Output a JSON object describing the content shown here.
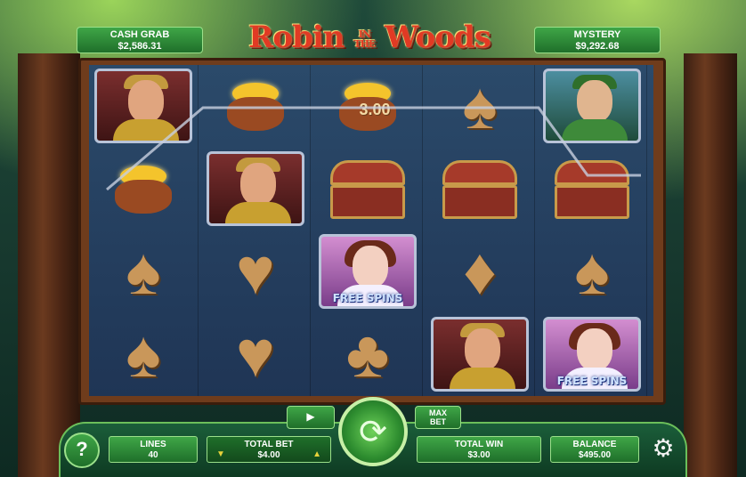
{
  "jackpots": {
    "cash_grab": {
      "label": "CASH GRAB",
      "value": "$2,586.31"
    },
    "mystery": {
      "label": "MYSTERY",
      "value": "$9,292.68"
    }
  },
  "title": {
    "main_left": "Robin",
    "small_top": "IN",
    "small_bottom": "THE",
    "main_right": "Woods"
  },
  "reels": {
    "symbols": [
      [
        "guard",
        "gold-bag",
        "spade",
        "spade"
      ],
      [
        "gold-bag",
        "guard",
        "heart",
        "heart"
      ],
      [
        "gold-bag",
        "chest",
        "free-spins-maiden",
        "club"
      ],
      [
        "spade",
        "chest",
        "diamond",
        "guard"
      ],
      [
        "robin",
        "chest",
        "spade",
        "free-spins-maiden"
      ]
    ],
    "win_amount_label": "3.00",
    "free_spins_label": "FREE SPINS"
  },
  "controls": {
    "help_label": "?",
    "lines_label": "LINES",
    "lines_value": "40",
    "total_bet_label": "TOTAL BET",
    "total_bet_value": "$4.00",
    "autoplay_label": "▶",
    "max_bet_label_top": "MAX",
    "max_bet_label_bottom": "BET",
    "total_win_label": "TOTAL WIN",
    "total_win_value": "$3.00",
    "balance_label": "BALANCE",
    "balance_value": "$495.00",
    "settings_icon": "gear-icon",
    "spin_icon": "spin-arrows-icon"
  },
  "colors": {
    "plate_green": "#3fa647",
    "title_red": "#e13a24",
    "reel_blue": "#2b4a6a",
    "wood": "#6f3c1c"
  }
}
